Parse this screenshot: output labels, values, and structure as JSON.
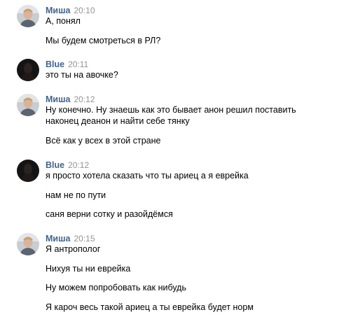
{
  "messages": [
    {
      "author": "Миша",
      "time": "20:10",
      "avatar": "misha-avatar",
      "lines": [
        "А, понял",
        "Мы будем смотреться в РЛ?"
      ]
    },
    {
      "author": "Blue",
      "time": "20:11",
      "avatar": "blue-avatar",
      "lines": [
        "это ты на авочке?"
      ]
    },
    {
      "author": "Миша",
      "time": "20:12",
      "avatar": "misha-avatar",
      "lines": [
        "Ну конечно. Ну знаешь как это бывает анон решил поставить",
        "наконец деанон и найти себе тянку",
        "Всё как у всех в этой стране"
      ]
    },
    {
      "author": "Blue",
      "time": "20:12",
      "avatar": "blue-avatar",
      "lines": [
        "я просто хотела сказать что ты ариец а я еврейка",
        "нам не по пути",
        "саня верни сотку и разойдёмся"
      ]
    },
    {
      "author": "Миша",
      "time": "20:15",
      "avatar": "misha-avatar",
      "lines": [
        "Я антрополог",
        "Нихуя ты ни еврейка",
        "Ну можем попробовать как нибудь",
        "Я кароч весь такой ариец а ты еврейка будет норм"
      ]
    }
  ],
  "colors": {
    "author": "#42648b",
    "time": "#939393",
    "text": "#000000"
  }
}
